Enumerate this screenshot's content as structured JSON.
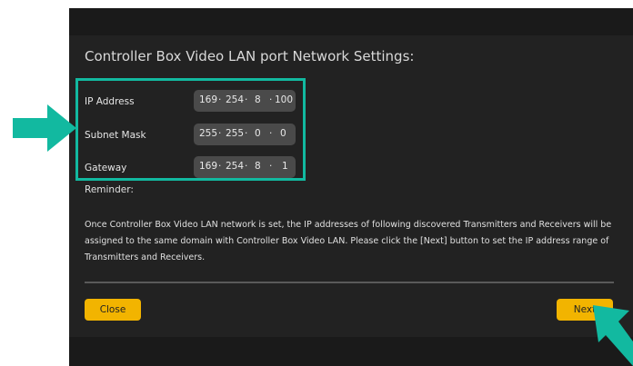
{
  "dialog": {
    "title": "Controller Box Video LAN port Network Settings:",
    "fields": [
      {
        "label": "IP Address",
        "octets": [
          "169",
          "254",
          "8",
          "100"
        ]
      },
      {
        "label": "Subnet Mask",
        "octets": [
          "255",
          "255",
          "0",
          "0"
        ]
      },
      {
        "label": "Gateway",
        "octets": [
          "169",
          "254",
          "8",
          "1"
        ]
      }
    ],
    "reminder_label": "Reminder:",
    "reminder_text": "Once Controller Box Video LAN network is set, the IP addresses of following discovered Transmitters and Receivers will be assigned to the same domain with Controller Box Video LAN. Please click the [Next] button to set the IP address range of Transmitters and Receivers.",
    "close_label": "Close",
    "next_label": "Next"
  },
  "colors": {
    "annotation_teal": "#12b9a0",
    "button_yellow": "#f2b400",
    "dialog_bg": "#222222",
    "field_bg": "#4a4a4a"
  },
  "annotations": {
    "left_arrow_icon": "arrow-right-icon",
    "corner_arrow_icon": "arrow-up-left-icon"
  }
}
